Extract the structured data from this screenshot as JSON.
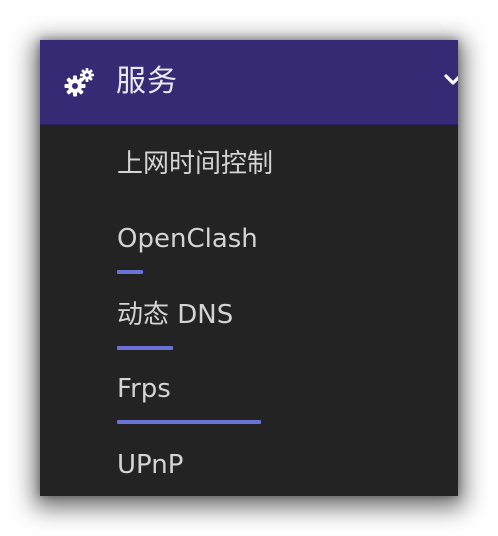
{
  "header": {
    "title": "服务",
    "icon": "gears-icon",
    "expand_icon": "chevron-down-icon"
  },
  "items": [
    {
      "label": "上网时间控制"
    },
    {
      "label": "OpenClash"
    },
    {
      "label": "动态 DNS"
    },
    {
      "label": "Frps"
    },
    {
      "label": "UPnP"
    }
  ],
  "colors": {
    "header_background": "#372a75",
    "menu_background": "#232323",
    "text": "#d4d4d4",
    "accent": "#6a72d6"
  }
}
